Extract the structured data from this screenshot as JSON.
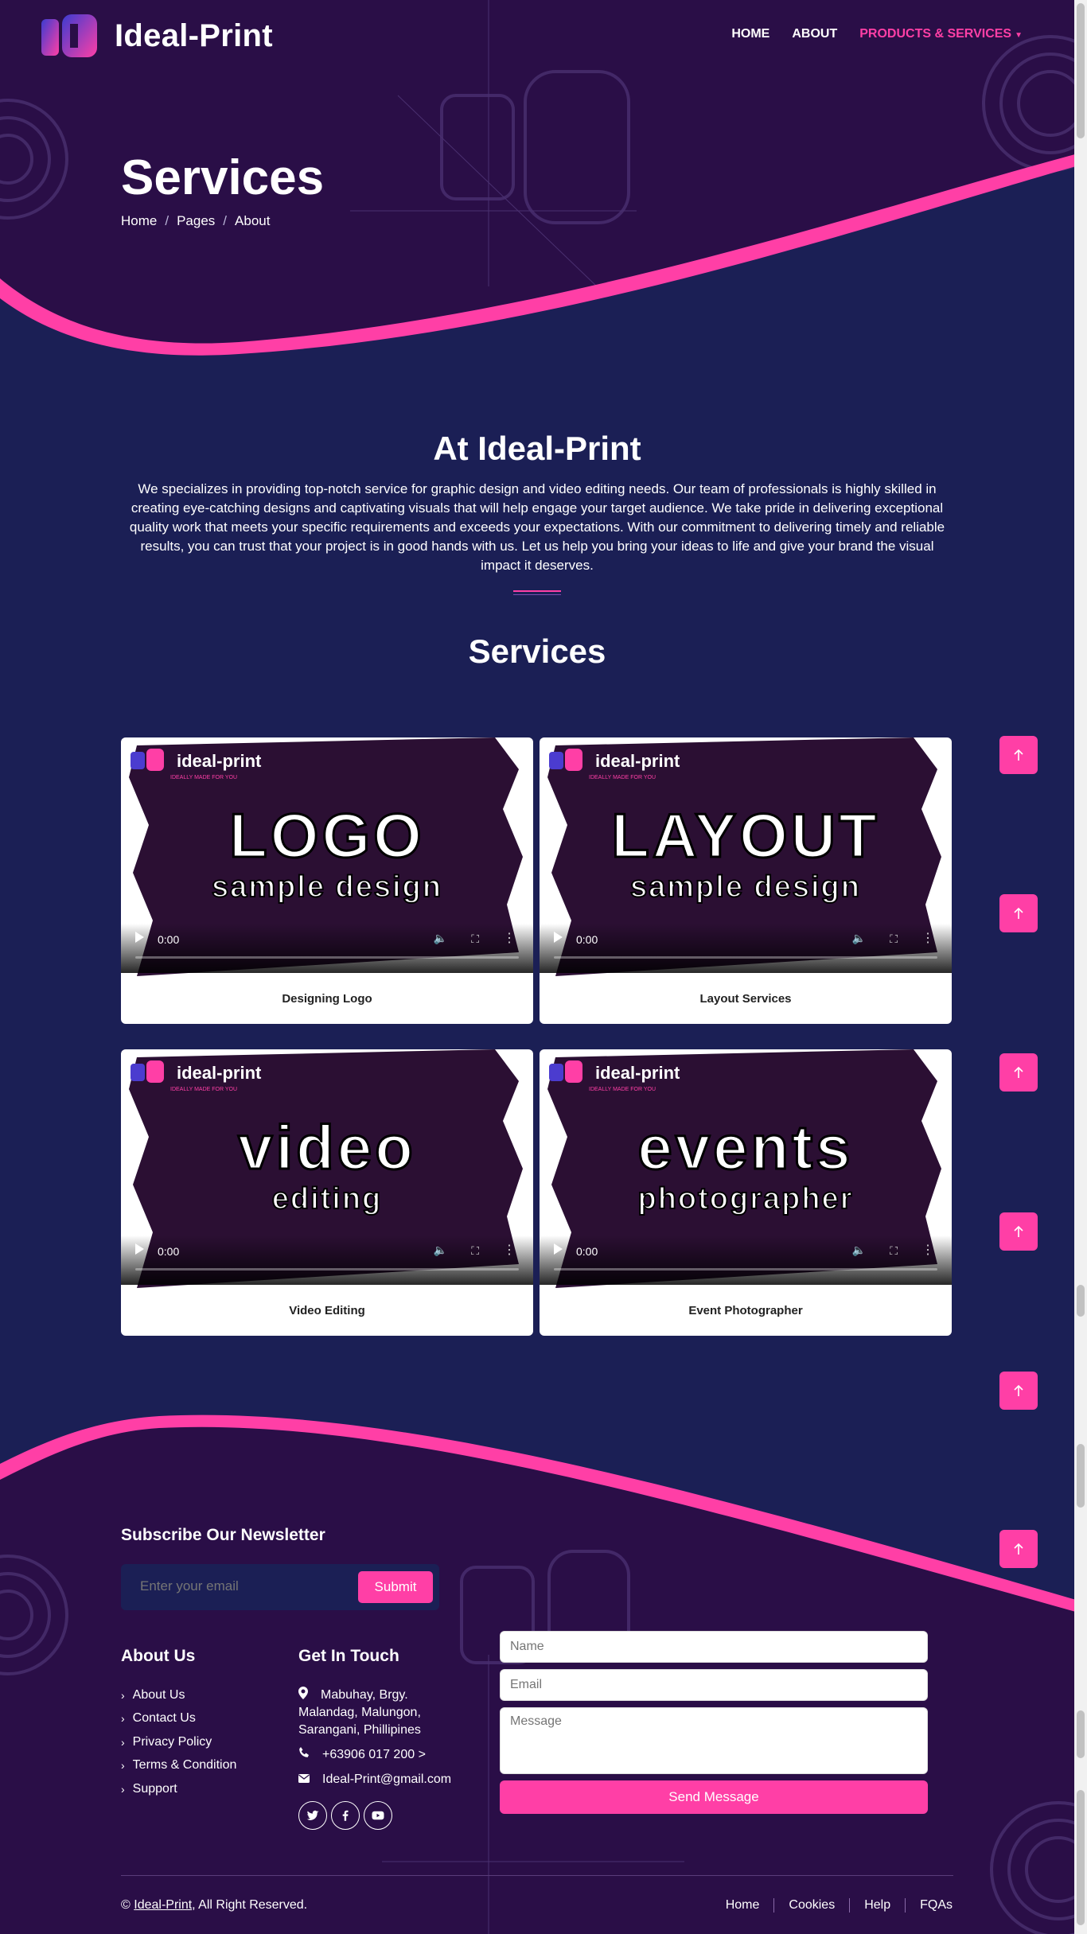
{
  "brand": {
    "name": "Ideal-Print"
  },
  "nav": {
    "home": "HOME",
    "about": "ABOUT",
    "products": "PRODUCTS & SERVICES"
  },
  "hero": {
    "title": "Services",
    "breadcrumb": [
      "Home",
      "Pages",
      "About"
    ],
    "separator": "/"
  },
  "about": {
    "title": "At Ideal-Print",
    "text": "We specializes in providing top-notch service for graphic design and video editing needs. Our team of professionals is highly skilled in creating eye-catching designs and captivating visuals that will help engage your target audience. We take pride in delivering exceptional quality work that meets your specific requirements and exceeds your expectations. With our commitment to delivering timely and reliable results, you can trust that your project is in good hands with us. Let us help you bring your ideas to life and give your brand the visual impact it deserves."
  },
  "services": {
    "title": "Services",
    "cards": [
      {
        "caption": "Designing Logo",
        "thumb_brand": "ideal-print",
        "thumb_tag": "IDEALLY MADE FOR YOU",
        "thumb_title": "LOGO",
        "thumb_sub": "sample design",
        "time": "0:00"
      },
      {
        "caption": "Layout Services",
        "thumb_brand": "ideal-print",
        "thumb_tag": "IDEALLY MADE FOR YOU",
        "thumb_title": "LAYOUT",
        "thumb_sub": "sample design",
        "time": "0:00"
      },
      {
        "caption": "Video Editing",
        "thumb_brand": "ideal-print",
        "thumb_tag": "IDEALLY MADE FOR YOU",
        "thumb_title": "video",
        "thumb_sub": "editing",
        "time": "0:00"
      },
      {
        "caption": "Event Photographer",
        "thumb_brand": "ideal-print",
        "thumb_tag": "IDEALLY MADE FOR YOU",
        "thumb_title": "events",
        "thumb_sub": "photographer",
        "time": "0:00"
      }
    ]
  },
  "newsletter": {
    "title": "Subscribe Our Newsletter",
    "placeholder": "Enter your email",
    "submit": "Submit"
  },
  "about_us": {
    "title": "About Us",
    "links": [
      "About Us",
      "Contact Us",
      "Privacy Policy",
      "Terms & Condition",
      "Support"
    ]
  },
  "contact": {
    "title": "Get In Touch",
    "address": "Mabuhay, Brgy. Malandag, Malungon, Sarangani, Phillipines",
    "phone": "+63906 017 200 >",
    "email": "Ideal-Print@gmail.com"
  },
  "form": {
    "name_placeholder": "Name",
    "email_placeholder": "Email",
    "message_placeholder": "Message",
    "send": "Send Message"
  },
  "footer": {
    "copyright_prefix": "©",
    "copyright_brand": "Ideal-Print",
    "copyright_suffix": ", All Right Reserved.",
    "links": [
      "Home",
      "Cookies",
      "Help",
      "FQAs"
    ]
  },
  "colors": {
    "accent": "#ff3fa6",
    "hero_bg": "#2a0e47",
    "page_bg": "#1b1f55",
    "footer_bg": "#2a0e47"
  },
  "icons": {
    "scroll_top": "arrow-up-icon",
    "social": [
      "twitter-icon",
      "facebook-icon",
      "youtube-icon"
    ]
  }
}
